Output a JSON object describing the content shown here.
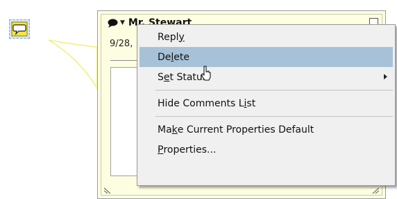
{
  "comment": {
    "author": "Mr. Stewart",
    "date": "9/28,"
  },
  "menu": {
    "reply": [
      "Repl",
      "y",
      ""
    ],
    "delete": [
      "De",
      "l",
      "ete"
    ],
    "set_status": [
      "S",
      "e",
      "t Status"
    ],
    "hide_comments": [
      "Hide Comments L",
      "i",
      "st"
    ],
    "make_default": [
      "Ma",
      "k",
      "e Current Properties Default"
    ],
    "properties": [
      "",
      "P",
      "roperties..."
    ]
  },
  "colors": {
    "highlight": "#a7c2d8",
    "note_background": "#fdfde2",
    "connector": "#f2ee7a"
  },
  "icons": {
    "note": "speech-bubble-icon",
    "submenu": "chevron-right-icon",
    "cursor": "mouse-pointer-icon"
  }
}
